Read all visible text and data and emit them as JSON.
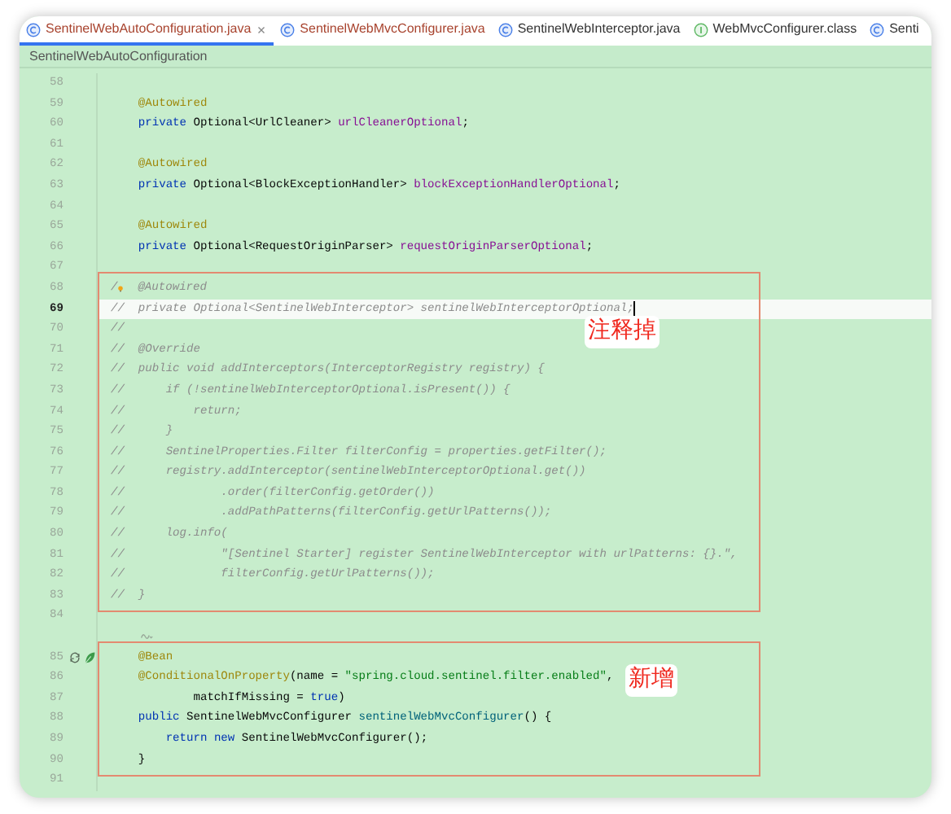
{
  "tabs": [
    {
      "label": "SentinelWebAutoConfiguration.java",
      "kind": "class",
      "modified": true,
      "selected": true
    },
    {
      "label": "SentinelWebMvcConfigurer.java",
      "kind": "class",
      "modified": true,
      "selected": false
    },
    {
      "label": "SentinelWebInterceptor.java",
      "kind": "class",
      "modified": false,
      "selected": false
    },
    {
      "label": "WebMvcConfigurer.class",
      "kind": "interface",
      "modified": false,
      "selected": false
    },
    {
      "label": "Senti",
      "kind": "class",
      "modified": false,
      "selected": false
    }
  ],
  "breadcrumb": "SentinelWebAutoConfiguration",
  "blocks": [
    {
      "kind": "plain",
      "lines": [
        {
          "kind": "code",
          "number": "58",
          "current": false
        },
        {
          "kind": "code",
          "number": "59",
          "current": false,
          "tokens": [
            {
              "kind": "ann",
              "text": "    @Autowired"
            }
          ]
        },
        {
          "kind": "code",
          "number": "60",
          "current": false,
          "tokens": [
            {
              "kind": "kw",
              "text": "    private"
            },
            {
              "kind": "plain",
              "text": " Optional<UrlCleaner> "
            },
            {
              "kind": "field",
              "text": "urlCleanerOptional"
            },
            {
              "kind": "plain",
              "text": ";"
            }
          ]
        },
        {
          "kind": "code",
          "number": "61",
          "current": false
        },
        {
          "kind": "code",
          "number": "62",
          "current": false,
          "tokens": [
            {
              "kind": "ann",
              "text": "    @Autowired"
            }
          ]
        },
        {
          "kind": "code",
          "number": "63",
          "current": false,
          "tokens": [
            {
              "kind": "kw",
              "text": "    private"
            },
            {
              "kind": "plain",
              "text": " Optional<BlockExceptionHandler> "
            },
            {
              "kind": "field",
              "text": "blockExceptionHandlerOptional"
            },
            {
              "kind": "plain",
              "text": ";"
            }
          ]
        },
        {
          "kind": "code",
          "number": "64",
          "current": false
        },
        {
          "kind": "code",
          "number": "65",
          "current": false,
          "tokens": [
            {
              "kind": "ann",
              "text": "    @Autowired"
            }
          ]
        },
        {
          "kind": "code",
          "number": "66",
          "current": false,
          "tokens": [
            {
              "kind": "kw",
              "text": "    private"
            },
            {
              "kind": "plain",
              "text": " Optional<RequestOriginParser> "
            },
            {
              "kind": "field",
              "text": "requestOriginParserOptional"
            },
            {
              "kind": "plain",
              "text": ";"
            }
          ]
        },
        {
          "kind": "code",
          "number": "67",
          "current": false
        }
      ]
    },
    {
      "kind": "callout",
      "label": "注释掉",
      "lines": [
        {
          "kind": "code",
          "number": "68",
          "current": false,
          "tokens": [
            {
              "kind": "comment",
              "text": "/"
            },
            {
              "kind": "bulb"
            },
            {
              "kind": "comment",
              "text": "  @Autowired"
            }
          ]
        },
        {
          "kind": "code",
          "number": "69",
          "current": true,
          "tokens": [
            {
              "kind": "comment",
              "text": "//  private Optional<SentinelWebInterceptor> sentinelWebInterceptorOptional;"
            }
          ]
        },
        {
          "kind": "code",
          "number": "70",
          "current": false,
          "tokens": [
            {
              "kind": "comment",
              "text": "//"
            }
          ]
        },
        {
          "kind": "code",
          "number": "71",
          "current": false,
          "tokens": [
            {
              "kind": "comment",
              "text": "//  @Override"
            }
          ]
        },
        {
          "kind": "code",
          "number": "72",
          "current": false,
          "tokens": [
            {
              "kind": "comment",
              "text": "//  public void addInterceptors(InterceptorRegistry registry) {"
            }
          ]
        },
        {
          "kind": "code",
          "number": "73",
          "current": false,
          "tokens": [
            {
              "kind": "comment",
              "text": "//      if (!sentinelWebInterceptorOptional.isPresent()) {"
            }
          ]
        },
        {
          "kind": "code",
          "number": "74",
          "current": false,
          "tokens": [
            {
              "kind": "comment",
              "text": "//          return;"
            }
          ]
        },
        {
          "kind": "code",
          "number": "75",
          "current": false,
          "tokens": [
            {
              "kind": "comment",
              "text": "//      }"
            }
          ]
        },
        {
          "kind": "code",
          "number": "76",
          "current": false,
          "tokens": [
            {
              "kind": "comment",
              "text": "//      SentinelProperties.Filter filterConfig = properties.getFilter();"
            }
          ]
        },
        {
          "kind": "code",
          "number": "77",
          "current": false,
          "tokens": [
            {
              "kind": "comment",
              "text": "//      registry.addInterceptor(sentinelWebInterceptorOptional.get())"
            }
          ]
        },
        {
          "kind": "code",
          "number": "78",
          "current": false,
          "tokens": [
            {
              "kind": "comment",
              "text": "//              .order(filterConfig.getOrder())"
            }
          ]
        },
        {
          "kind": "code",
          "number": "79",
          "current": false,
          "tokens": [
            {
              "kind": "comment",
              "text": "//              .addPathPatterns(filterConfig.getUrlPatterns());"
            }
          ]
        },
        {
          "kind": "code",
          "number": "80",
          "current": false,
          "tokens": [
            {
              "kind": "comment",
              "text": "//      log.info("
            }
          ]
        },
        {
          "kind": "code",
          "number": "81",
          "current": false,
          "tokens": [
            {
              "kind": "comment",
              "text": "//              \"[Sentinel Starter] register SentinelWebInterceptor with urlPatterns: {}.\","
            }
          ]
        },
        {
          "kind": "code",
          "number": "82",
          "current": false,
          "tokens": [
            {
              "kind": "comment",
              "text": "//              filterConfig.getUrlPatterns());"
            }
          ]
        },
        {
          "kind": "code",
          "number": "83",
          "current": false,
          "tokens": [
            {
              "kind": "comment",
              "text": "//  }"
            }
          ]
        }
      ]
    },
    {
      "kind": "plain",
      "lines": [
        {
          "kind": "code",
          "number": "84",
          "current": false
        },
        {
          "kind": "inlay"
        }
      ]
    },
    {
      "kind": "callout",
      "label": "新增",
      "lines": [
        {
          "kind": "code",
          "number": "85",
          "current": false,
          "gutter_icons": [
            {
              "kind": "cycle"
            },
            {
              "kind": "bean"
            }
          ],
          "tokens": [
            {
              "kind": "ann",
              "text": "    @Bean"
            }
          ]
        },
        {
          "kind": "code",
          "number": "86",
          "current": false,
          "tokens": [
            {
              "kind": "ann",
              "text": "    @ConditionalOnProperty"
            },
            {
              "kind": "plain",
              "text": "(name = "
            },
            {
              "kind": "str",
              "text": "\"spring.cloud.sentinel.filter.enabled\""
            },
            {
              "kind": "plain",
              "text": ","
            }
          ]
        },
        {
          "kind": "code",
          "number": "87",
          "current": false,
          "tokens": [
            {
              "kind": "plain",
              "text": "            matchIfMissing = "
            },
            {
              "kind": "kw",
              "text": "true"
            },
            {
              "kind": "plain",
              "text": ")"
            }
          ]
        },
        {
          "kind": "code",
          "number": "88",
          "current": false,
          "tokens": [
            {
              "kind": "kw",
              "text": "    public"
            },
            {
              "kind": "plain",
              "text": " SentinelWebMvcConfigurer "
            },
            {
              "kind": "method",
              "text": "sentinelWebMvcConfigurer"
            },
            {
              "kind": "plain",
              "text": "() {"
            }
          ]
        },
        {
          "kind": "code",
          "number": "89",
          "current": false,
          "tokens": [
            {
              "kind": "kw",
              "text": "        return"
            },
            {
              "kind": "kw",
              "text": " new"
            },
            {
              "kind": "plain",
              "text": " SentinelWebMvcConfigurer();"
            }
          ]
        },
        {
          "kind": "code",
          "number": "90",
          "current": false,
          "tokens": [
            {
              "kind": "plain",
              "text": "    }"
            }
          ]
        }
      ]
    },
    {
      "kind": "plain",
      "lines": [
        {
          "kind": "code",
          "number": "91",
          "current": false
        }
      ]
    }
  ]
}
